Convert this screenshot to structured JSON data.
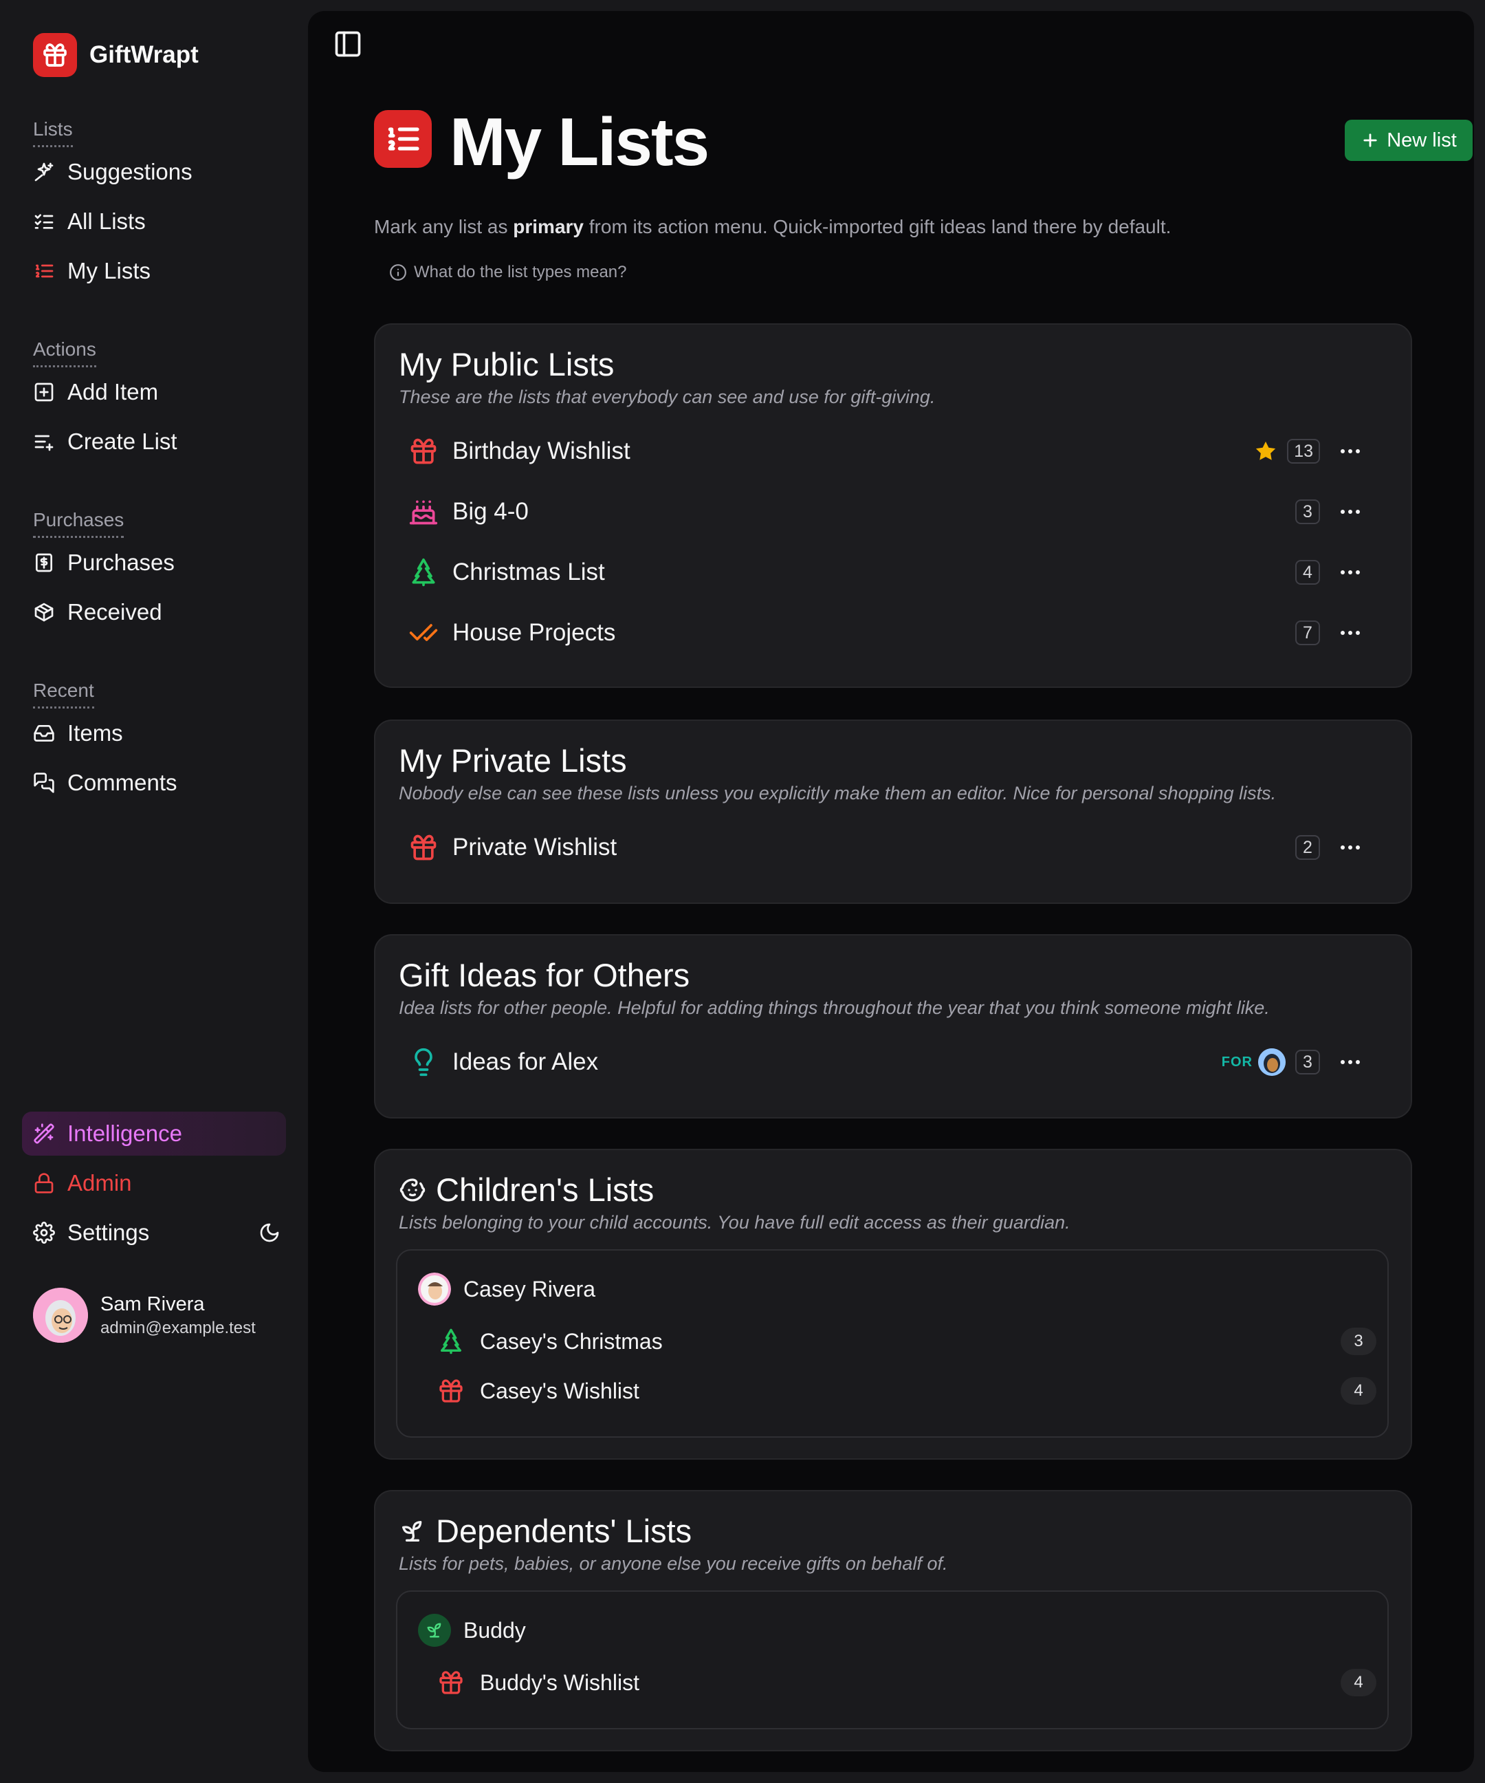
{
  "brand": {
    "name": "GiftWrapt",
    "icon": "gift-icon",
    "color": "#dc2626"
  },
  "sidebar": {
    "groups": [
      {
        "heading": "Lists",
        "items": [
          {
            "label": "Suggestions",
            "icon": "sparkles-icon"
          },
          {
            "label": "All Lists",
            "icon": "list-checks-icon"
          },
          {
            "label": "My Lists",
            "icon": "list-ordered-icon",
            "active": true
          }
        ]
      },
      {
        "heading": "Actions",
        "items": [
          {
            "label": "Add Item",
            "icon": "square-plus-icon"
          },
          {
            "label": "Create List",
            "icon": "list-plus-icon"
          }
        ]
      },
      {
        "heading": "Purchases",
        "items": [
          {
            "label": "Purchases",
            "icon": "receipt-icon"
          },
          {
            "label": "Received",
            "icon": "package-icon"
          }
        ]
      },
      {
        "heading": "Recent",
        "items": [
          {
            "label": "Items",
            "icon": "inbox-icon"
          },
          {
            "label": "Comments",
            "icon": "messages-icon"
          }
        ]
      }
    ],
    "intelligence": "Intelligence",
    "admin": "Admin",
    "settings": "Settings",
    "user": {
      "name": "Sam Rivera",
      "email": "admin@example.test"
    }
  },
  "page": {
    "title": "My Lists",
    "new_list_label": "New list",
    "subtitle_before": "Mark any list as ",
    "subtitle_bold": "primary",
    "subtitle_after": " from its action menu. Quick-imported gift ideas land there by default.",
    "help_text": "What do the list types mean?"
  },
  "sections": {
    "public": {
      "title": "My Public Lists",
      "description": "These are the lists that everybody can see and use for gift-giving.",
      "lists": [
        {
          "label": "Birthday Wishlist",
          "icon": "gift-icon",
          "count": "13",
          "primary": true
        },
        {
          "label": "Big 4-0",
          "icon": "cake-icon",
          "count": "3"
        },
        {
          "label": "Christmas List",
          "icon": "tree-icon",
          "count": "4"
        },
        {
          "label": "House Projects",
          "icon": "check-check-icon",
          "count": "7"
        }
      ]
    },
    "private": {
      "title": "My Private Lists",
      "description": "Nobody else can see these lists unless you explicitly make them an editor. Nice for personal shopping lists.",
      "lists": [
        {
          "label": "Private Wishlist",
          "icon": "gift-icon",
          "count": "2"
        }
      ]
    },
    "ideas": {
      "title": "Gift Ideas for Others",
      "description": "Idea lists for other people. Helpful for adding things throughout the year that you think someone might like.",
      "lists": [
        {
          "label": "Ideas for Alex",
          "icon": "lightbulb-icon",
          "for_tag": "FOR",
          "count": "3"
        }
      ]
    },
    "children": {
      "title": "Children's Lists",
      "description": "Lists belonging to your child accounts. You have full edit access as their guardian.",
      "child": "Casey Rivera",
      "lists": [
        {
          "label": "Casey's Christmas",
          "icon": "tree-icon",
          "count": "3"
        },
        {
          "label": "Casey's Wishlist",
          "icon": "gift-icon",
          "count": "4"
        }
      ]
    },
    "dependents": {
      "title": "Dependents' Lists",
      "description": "Lists for pets, babies, or anyone else you receive gifts on behalf of.",
      "dependent": "Buddy",
      "lists": [
        {
          "label": "Buddy's Wishlist",
          "icon": "gift-icon",
          "count": "4"
        }
      ]
    }
  },
  "colors": {
    "red": "#ef4444",
    "pink": "#ec4899",
    "green": "#22c55e",
    "orange": "#f97316",
    "teal": "#14b8a6",
    "star": "#f5b301",
    "purple": "#e879f9",
    "button_green": "#15803d"
  }
}
